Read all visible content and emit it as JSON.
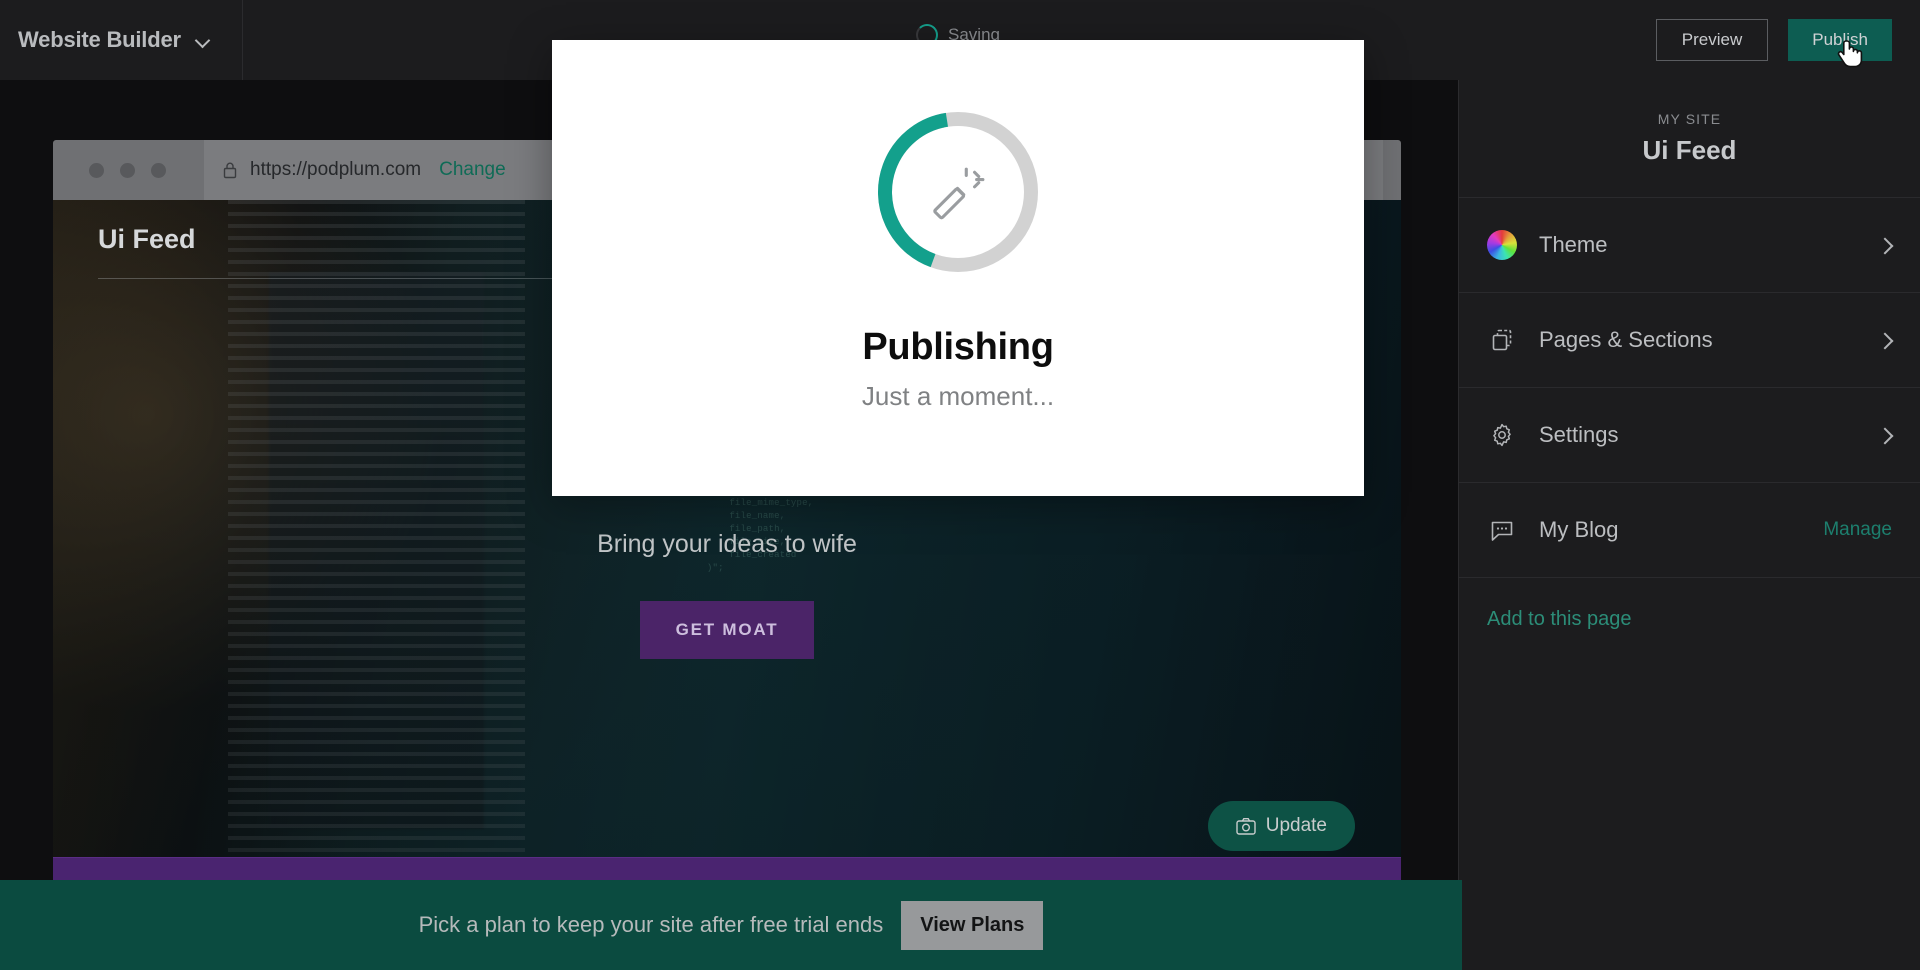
{
  "topbar": {
    "brand": "Website Builder",
    "brand_caret_icon": "chevron-down-icon",
    "saving_text": "Saving",
    "saving_spinner_icon": "spinner-icon",
    "preview_label": "Preview",
    "publish_label": "Publish",
    "cursor_icon": "pointer-hand-cursor"
  },
  "sidebar": {
    "site_label": "MY SITE",
    "site_name": "Ui Feed",
    "items": [
      {
        "label": "Theme",
        "icon": "color-wheel-icon",
        "chevron": "chevron-right-icon",
        "action": null
      },
      {
        "label": "Pages & Sections",
        "icon": "pages-icon",
        "chevron": "chevron-right-icon",
        "action": null
      },
      {
        "label": "Settings",
        "icon": "gear-icon",
        "chevron": "chevron-right-icon",
        "action": null
      },
      {
        "label": "My Blog",
        "icon": "chat-bubble-icon",
        "chevron": null,
        "action": "Manage"
      }
    ],
    "add_link": "Add to this page"
  },
  "browser": {
    "lock_icon": "lock-icon",
    "url": "https://podplum.com",
    "change_label": "Change"
  },
  "site_preview": {
    "logo": "Ui Feed",
    "hero_title": "Ui Feed",
    "hero_subtitle": "Bring your ideas to wife",
    "hero_cta": "GET MOAT",
    "update_label": "Update",
    "update_icon": "camera-icon"
  },
  "modal": {
    "title": "Publishing",
    "subtitle": "Just a moment...",
    "spinner_icon": "magic-wand-icon",
    "progress_percent": 42,
    "track_color": "#d2d2d2",
    "arc_color": "#13a08c"
  },
  "banner": {
    "message": "Pick a plan to keep your site after free trial ends",
    "button_label": "View Plans"
  },
  "colors": {
    "teal": "#13a08c",
    "publish_green": "#0d5d52",
    "banner_green": "#0b4b40",
    "purple": "#4a2470",
    "dark_chrome": "#1c1c1e"
  }
}
